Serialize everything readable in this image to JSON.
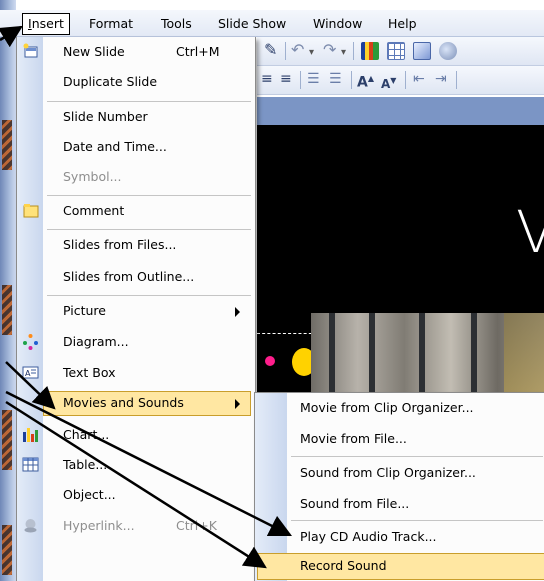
{
  "menubar": {
    "items": [
      {
        "label": "Insert",
        "active": true
      },
      {
        "label": "Format"
      },
      {
        "label": "Tools"
      },
      {
        "label": "Slide Show"
      },
      {
        "label": "Window"
      },
      {
        "label": "Help"
      }
    ]
  },
  "insert_menu": {
    "items": [
      {
        "label": "New Slide",
        "shortcut": "Ctrl+M",
        "icon": "new-slide-icon"
      },
      {
        "label": "Duplicate Slide"
      },
      {
        "label": "Slide Number"
      },
      {
        "label": "Date and Time..."
      },
      {
        "label": "Symbol...",
        "disabled": true
      },
      {
        "label": "Comment",
        "icon": "comment-icon"
      },
      {
        "label": "Slides from Files..."
      },
      {
        "label": "Slides from Outline..."
      },
      {
        "label": "Picture",
        "submenu": true
      },
      {
        "label": "Diagram...",
        "icon": "diagram-icon"
      },
      {
        "label": "Text Box",
        "icon": "text-box-icon"
      },
      {
        "label": "Movies and Sounds",
        "submenu": true,
        "highlighted": true
      },
      {
        "label": "Chart...",
        "icon": "chart-icon"
      },
      {
        "label": "Table...",
        "icon": "table-icon"
      },
      {
        "label": "Object..."
      },
      {
        "label": "Hyperlink...",
        "shortcut": "Ctrl+K",
        "disabled": true,
        "icon": "hyperlink-icon"
      }
    ]
  },
  "movies_submenu": {
    "items": [
      {
        "label": "Movie from Clip Organizer..."
      },
      {
        "label": "Movie from File..."
      },
      {
        "label": "Sound from Clip Organizer..."
      },
      {
        "label": "Sound from File..."
      },
      {
        "label": "Play CD Audio Track..."
      },
      {
        "label": "Record Sound",
        "highlighted": true
      }
    ]
  },
  "slide": {
    "visible_letter": "V"
  },
  "colors": {
    "highlight": "#ffe7a2",
    "highlight_border": "#c99e2c",
    "menu_gutter": "#c9d7ee"
  }
}
